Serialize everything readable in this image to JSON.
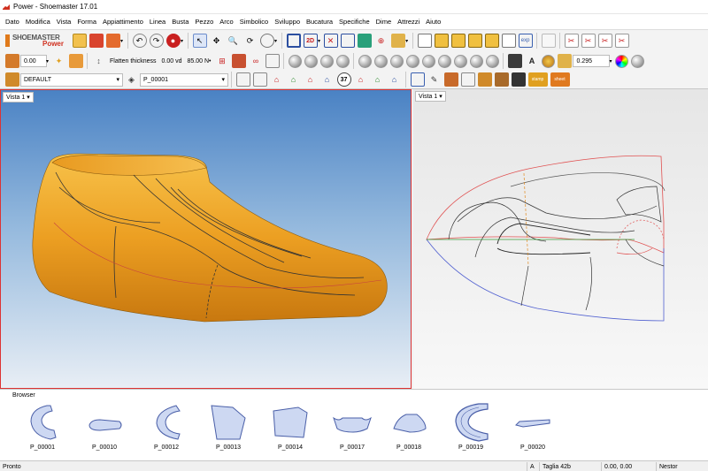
{
  "window": {
    "title": "Power - Shoemaster 17.01"
  },
  "menu": [
    "Dato",
    "Modifica",
    "Vista",
    "Forma",
    "Appiattimento",
    "Linea",
    "Busta",
    "Pezzo",
    "Arco",
    "Simbolico",
    "Sviluppo",
    "Bucatura",
    "Specifiche",
    "Dime",
    "Attrezzi",
    "Aiuto"
  ],
  "logo": {
    "line1": "SHOEMASTER",
    "line2": "Power"
  },
  "toolbar2": {
    "value1": "0.00",
    "flatten_label": "Flatten thickness",
    "flatten_value": "0.00 vd",
    "flatten_value2": "85.00 N•",
    "right_value": "0.295"
  },
  "toolbar3": {
    "style_combo": "DEFAULT",
    "piece_combo": "P_00001",
    "size_badge": "37",
    "stamp1": "stamp",
    "stamp2": "sheet"
  },
  "view1": {
    "label": "Vista 1"
  },
  "view2": {
    "label": "Vista 1"
  },
  "browser": {
    "title": "Browser",
    "pieces": [
      "P_00001",
      "P_00010",
      "P_00012",
      "P_00013",
      "P_00014",
      "P_00017",
      "P_00018",
      "P_00019",
      "P_00020"
    ]
  },
  "status": {
    "text": "Pronto",
    "mode": "A",
    "size": "Taglia 42b",
    "coords": "0.00, 0.00",
    "profile": "Nestor"
  },
  "colors": {
    "shoe": "#f0a528",
    "view_sky": "#4a82c4",
    "piece_fill": "#cdd8f2",
    "piece_stroke": "#4a5fa8"
  }
}
